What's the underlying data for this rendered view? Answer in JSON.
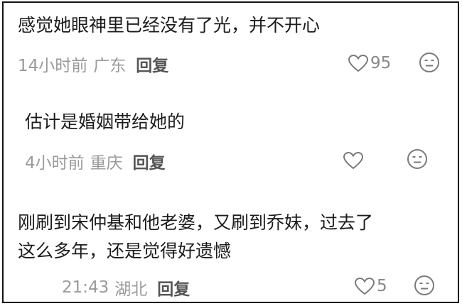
{
  "comments": [
    {
      "lines": [
        "感觉她眼神里已经没有了光，并不开心"
      ],
      "time": "14小时前",
      "location": "广东",
      "reply_label": "回复",
      "likes": "95",
      "like_icon": "heart-outline-icon",
      "dislike_icon": "neutral-face-icon"
    },
    {
      "lines": [
        "估计是婚姻带给她的"
      ],
      "time": "4小时前",
      "location": "重庆",
      "reply_label": "回复",
      "likes": "",
      "like_icon": "heart-outline-icon",
      "dislike_icon": "neutral-face-icon"
    },
    {
      "lines": [
        "刚刷到宋仲基和他老婆，又刷到乔妹，过去了",
        "这么多年，还是觉得好遗憾"
      ],
      "time": "21:43",
      "location": "湖北",
      "reply_label": "回复",
      "likes": "5",
      "like_icon": "heart-outline-icon",
      "dislike_icon": "neutral-face-icon"
    }
  ],
  "colors": {
    "text": "#1c1c1c",
    "meta": "#9a9a9a",
    "reply": "#555555",
    "icon": "#888888",
    "border": "#111111"
  }
}
